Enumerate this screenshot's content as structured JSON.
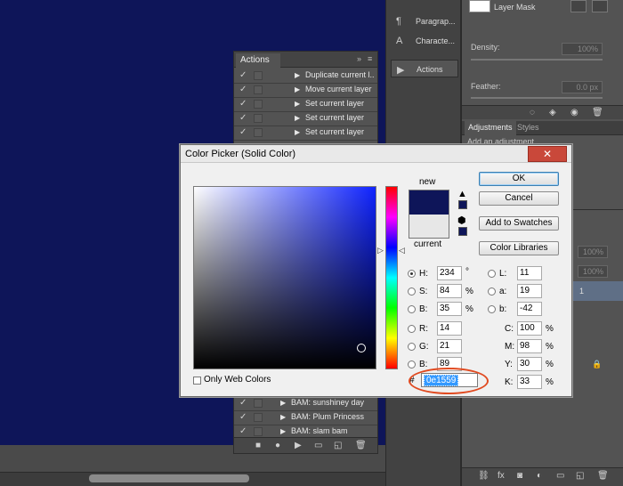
{
  "colors": {
    "canvas": "#0e1559",
    "accent_ring": "#e04a20",
    "selection": "#3399ff"
  },
  "actions_panel": {
    "tab_label": "Actions",
    "collapse_glyph": "»",
    "menu_glyph": "≡",
    "items": [
      {
        "label": "Duplicate current l..."
      },
      {
        "label": "Move current layer"
      },
      {
        "label": "Set current layer"
      },
      {
        "label": "Set current layer"
      },
      {
        "label": "Set current layer"
      }
    ],
    "bottom_items": [
      {
        "label": "BAM: sunshiney day"
      },
      {
        "label": "BAM: Plum Princess"
      },
      {
        "label": "BAM: slam bam"
      }
    ],
    "footer_icons": [
      "stop-icon",
      "record-icon",
      "play-icon",
      "new-set-icon",
      "new-action-icon",
      "trash-icon"
    ]
  },
  "dock": {
    "items": [
      {
        "label": "Paragrap...",
        "icon": "paragraph-icon"
      },
      {
        "label": "Characte...",
        "icon": "character-icon"
      },
      {
        "label": "Actions",
        "icon": "play-icon"
      }
    ]
  },
  "right_panel": {
    "mask_label": "Layer Mask",
    "density_label": "Density:",
    "density_value": "100%",
    "feather_label": "Feather:",
    "feather_value": "0.0 px",
    "adjustments_tab": "Adjustments",
    "styles_tab": "Styles",
    "add_adjustment": "Add an adjustment",
    "opacity_values": [
      "100%",
      "100%"
    ],
    "layer_number": "1"
  },
  "dialog": {
    "title": "Color Picker (Solid Color)",
    "close_glyph": "✕",
    "new_label": "new",
    "current_label": "current",
    "buttons": {
      "ok": "OK",
      "cancel": "Cancel",
      "add_swatches": "Add to Swatches",
      "color_libraries": "Color Libraries"
    },
    "hsb": [
      {
        "label": "H:",
        "value": "234",
        "unit": "°",
        "selected": true
      },
      {
        "label": "S:",
        "value": "84",
        "unit": "%",
        "selected": false
      },
      {
        "label": "B:",
        "value": "35",
        "unit": "%",
        "selected": false
      }
    ],
    "rgb": [
      {
        "label": "R:",
        "value": "14"
      },
      {
        "label": "G:",
        "value": "21"
      },
      {
        "label": "B:",
        "value": "89"
      }
    ],
    "lab": [
      {
        "label": "L:",
        "value": "11"
      },
      {
        "label": "a:",
        "value": "19"
      },
      {
        "label": "b:",
        "value": "-42"
      }
    ],
    "cmyk": [
      {
        "label": "C:",
        "value": "100",
        "unit": "%"
      },
      {
        "label": "M:",
        "value": "98",
        "unit": "%"
      },
      {
        "label": "Y:",
        "value": "30",
        "unit": "%"
      },
      {
        "label": "K:",
        "value": "33",
        "unit": "%"
      }
    ],
    "only_web_colors": "Only Web Colors",
    "hex_prefix": "#",
    "hex_value": "0e1559"
  }
}
